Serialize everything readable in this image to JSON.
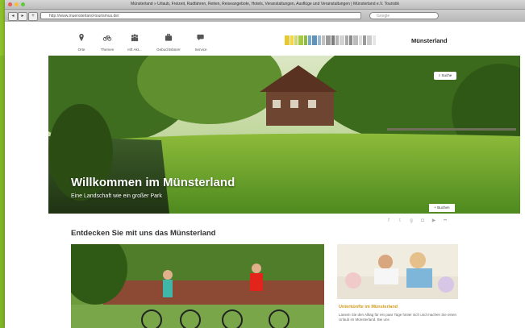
{
  "browser": {
    "window_title": "Münsterland » Urlaub, Freizeit, Radfahren, Reiten, Reiseangebote, Hotels, Veranstaltungen, Ausflüge und Veranstaltungen | Münsterland e.V. Touristik",
    "url": "http://www.muensterland-tourismus.de/",
    "search_placeholder": "Google"
  },
  "site": {
    "brand": "Münsterland",
    "nav": [
      {
        "label": "Orte",
        "icon": "map-pin-icon"
      },
      {
        "label": "Themen",
        "icon": "bicycle-icon"
      },
      {
        "label": "Inft Akt...",
        "icon": "people-icon"
      },
      {
        "label": "Gebuchtsbürer",
        "icon": "suitcase-icon"
      },
      {
        "label": "Service",
        "icon": "chat-icon"
      }
    ],
    "stripe_colors": [
      "#e8c930",
      "#f2d54d",
      "#cfd86a",
      "#a6c949",
      "#8fbd3f",
      "#7aa9c8",
      "#5f93bd",
      "#9db8cf",
      "#c0c0c0",
      "#9a9a9a",
      "#7c7c7c",
      "#b4b4b4",
      "#d2d2d2",
      "#a8a8a8",
      "#8c8c8c",
      "#bcbcbc",
      "#dedede",
      "#999999",
      "#cccccc",
      "#e6e6e6"
    ]
  },
  "hero": {
    "title": "Willkommen im Münsterland",
    "subtitle": "Eine Landschaft wie ein großer Park",
    "search_label": "Suche",
    "buchen_label": "+ Buchen"
  },
  "social_icons": [
    "facebook-icon",
    "twitter-icon",
    "googleplus-icon",
    "instagram-icon",
    "youtube-icon",
    "flickr-icon"
  ],
  "content": {
    "section_title": "Entdecken Sie mit uns das Münsterland",
    "card_title": "Unterkünfte im Münsterland",
    "card_text": "Lassen Sie den Alltag für ein paar Tage hinter sich und machen Sie einen Urlaub im Münsterland. Bei uns"
  },
  "colors": {
    "accent_green": "#8dc12b",
    "card_title": "#d19a1a"
  }
}
